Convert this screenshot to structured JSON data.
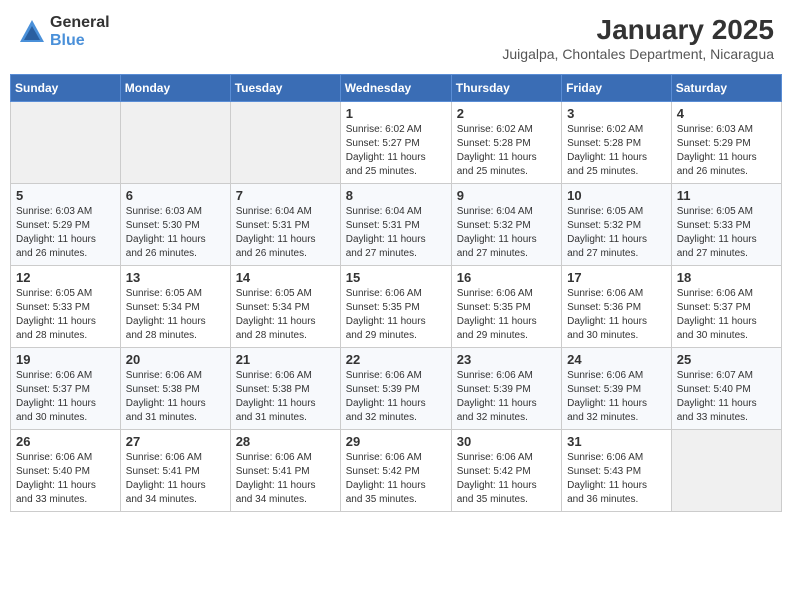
{
  "header": {
    "logo_general": "General",
    "logo_blue": "Blue",
    "month": "January 2025",
    "location": "Juigalpa, Chontales Department, Nicaragua"
  },
  "days_of_week": [
    "Sunday",
    "Monday",
    "Tuesday",
    "Wednesday",
    "Thursday",
    "Friday",
    "Saturday"
  ],
  "weeks": [
    [
      {
        "day": "",
        "info": ""
      },
      {
        "day": "",
        "info": ""
      },
      {
        "day": "",
        "info": ""
      },
      {
        "day": "1",
        "info": "Sunrise: 6:02 AM\nSunset: 5:27 PM\nDaylight: 11 hours\nand 25 minutes."
      },
      {
        "day": "2",
        "info": "Sunrise: 6:02 AM\nSunset: 5:28 PM\nDaylight: 11 hours\nand 25 minutes."
      },
      {
        "day": "3",
        "info": "Sunrise: 6:02 AM\nSunset: 5:28 PM\nDaylight: 11 hours\nand 25 minutes."
      },
      {
        "day": "4",
        "info": "Sunrise: 6:03 AM\nSunset: 5:29 PM\nDaylight: 11 hours\nand 26 minutes."
      }
    ],
    [
      {
        "day": "5",
        "info": "Sunrise: 6:03 AM\nSunset: 5:29 PM\nDaylight: 11 hours\nand 26 minutes."
      },
      {
        "day": "6",
        "info": "Sunrise: 6:03 AM\nSunset: 5:30 PM\nDaylight: 11 hours\nand 26 minutes."
      },
      {
        "day": "7",
        "info": "Sunrise: 6:04 AM\nSunset: 5:31 PM\nDaylight: 11 hours\nand 26 minutes."
      },
      {
        "day": "8",
        "info": "Sunrise: 6:04 AM\nSunset: 5:31 PM\nDaylight: 11 hours\nand 27 minutes."
      },
      {
        "day": "9",
        "info": "Sunrise: 6:04 AM\nSunset: 5:32 PM\nDaylight: 11 hours\nand 27 minutes."
      },
      {
        "day": "10",
        "info": "Sunrise: 6:05 AM\nSunset: 5:32 PM\nDaylight: 11 hours\nand 27 minutes."
      },
      {
        "day": "11",
        "info": "Sunrise: 6:05 AM\nSunset: 5:33 PM\nDaylight: 11 hours\nand 27 minutes."
      }
    ],
    [
      {
        "day": "12",
        "info": "Sunrise: 6:05 AM\nSunset: 5:33 PM\nDaylight: 11 hours\nand 28 minutes."
      },
      {
        "day": "13",
        "info": "Sunrise: 6:05 AM\nSunset: 5:34 PM\nDaylight: 11 hours\nand 28 minutes."
      },
      {
        "day": "14",
        "info": "Sunrise: 6:05 AM\nSunset: 5:34 PM\nDaylight: 11 hours\nand 28 minutes."
      },
      {
        "day": "15",
        "info": "Sunrise: 6:06 AM\nSunset: 5:35 PM\nDaylight: 11 hours\nand 29 minutes."
      },
      {
        "day": "16",
        "info": "Sunrise: 6:06 AM\nSunset: 5:35 PM\nDaylight: 11 hours\nand 29 minutes."
      },
      {
        "day": "17",
        "info": "Sunrise: 6:06 AM\nSunset: 5:36 PM\nDaylight: 11 hours\nand 30 minutes."
      },
      {
        "day": "18",
        "info": "Sunrise: 6:06 AM\nSunset: 5:37 PM\nDaylight: 11 hours\nand 30 minutes."
      }
    ],
    [
      {
        "day": "19",
        "info": "Sunrise: 6:06 AM\nSunset: 5:37 PM\nDaylight: 11 hours\nand 30 minutes."
      },
      {
        "day": "20",
        "info": "Sunrise: 6:06 AM\nSunset: 5:38 PM\nDaylight: 11 hours\nand 31 minutes."
      },
      {
        "day": "21",
        "info": "Sunrise: 6:06 AM\nSunset: 5:38 PM\nDaylight: 11 hours\nand 31 minutes."
      },
      {
        "day": "22",
        "info": "Sunrise: 6:06 AM\nSunset: 5:39 PM\nDaylight: 11 hours\nand 32 minutes."
      },
      {
        "day": "23",
        "info": "Sunrise: 6:06 AM\nSunset: 5:39 PM\nDaylight: 11 hours\nand 32 minutes."
      },
      {
        "day": "24",
        "info": "Sunrise: 6:06 AM\nSunset: 5:39 PM\nDaylight: 11 hours\nand 32 minutes."
      },
      {
        "day": "25",
        "info": "Sunrise: 6:07 AM\nSunset: 5:40 PM\nDaylight: 11 hours\nand 33 minutes."
      }
    ],
    [
      {
        "day": "26",
        "info": "Sunrise: 6:06 AM\nSunset: 5:40 PM\nDaylight: 11 hours\nand 33 minutes."
      },
      {
        "day": "27",
        "info": "Sunrise: 6:06 AM\nSunset: 5:41 PM\nDaylight: 11 hours\nand 34 minutes."
      },
      {
        "day": "28",
        "info": "Sunrise: 6:06 AM\nSunset: 5:41 PM\nDaylight: 11 hours\nand 34 minutes."
      },
      {
        "day": "29",
        "info": "Sunrise: 6:06 AM\nSunset: 5:42 PM\nDaylight: 11 hours\nand 35 minutes."
      },
      {
        "day": "30",
        "info": "Sunrise: 6:06 AM\nSunset: 5:42 PM\nDaylight: 11 hours\nand 35 minutes."
      },
      {
        "day": "31",
        "info": "Sunrise: 6:06 AM\nSunset: 5:43 PM\nDaylight: 11 hours\nand 36 minutes."
      },
      {
        "day": "",
        "info": ""
      }
    ]
  ]
}
